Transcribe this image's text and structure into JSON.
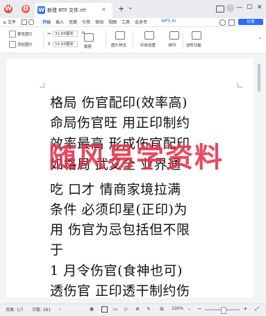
{
  "titlebar": {
    "tab_label": "新建 RTF 文件.rtf",
    "new_tab": "+",
    "tab_close": "×",
    "menu_caret": "⌄",
    "win_min": "—",
    "win_max": "▢",
    "win_close": "✕"
  },
  "menu": {
    "file": "≡ 文件",
    "start": "开始",
    "insert": "插入",
    "page": "页面",
    "reference": "引用",
    "review": "审阅",
    "view": "视图",
    "tools": "工具",
    "member": "会员专",
    "wps_ai": "WPS AI",
    "share": "分享"
  },
  "ribbon": {
    "change_image": "更改图片",
    "add_image": "添加图片",
    "width_value": "31.65厘米",
    "height_value": "14.93厘米",
    "crop": "裁剪",
    "image_style": "图片样式",
    "around_setting": "环绕设置",
    "arrange": "排列",
    "advanced": "进阶功能"
  },
  "document": {
    "lines": [
      "格局 伤官配印(效率高)",
      "命局伤官旺 用正印制约",
      "效率最高 形成伤官配印",
      "如格局 武艾全 业界通",
      "吃 口才 情商家境拉满",
      "条件 必须印星(正印)为",
      "用 伤官为忌包括但不限",
      "于",
      "1 月令伤官(食神也可)",
      "透伤官 正印透干制约伤"
    ],
    "watermark": "随风易学资料"
  },
  "status": {
    "page": "页面: 1/7",
    "words": "字数: 261",
    "zoom": "100%",
    "zoom_minus": "−",
    "zoom_plus": "+"
  }
}
